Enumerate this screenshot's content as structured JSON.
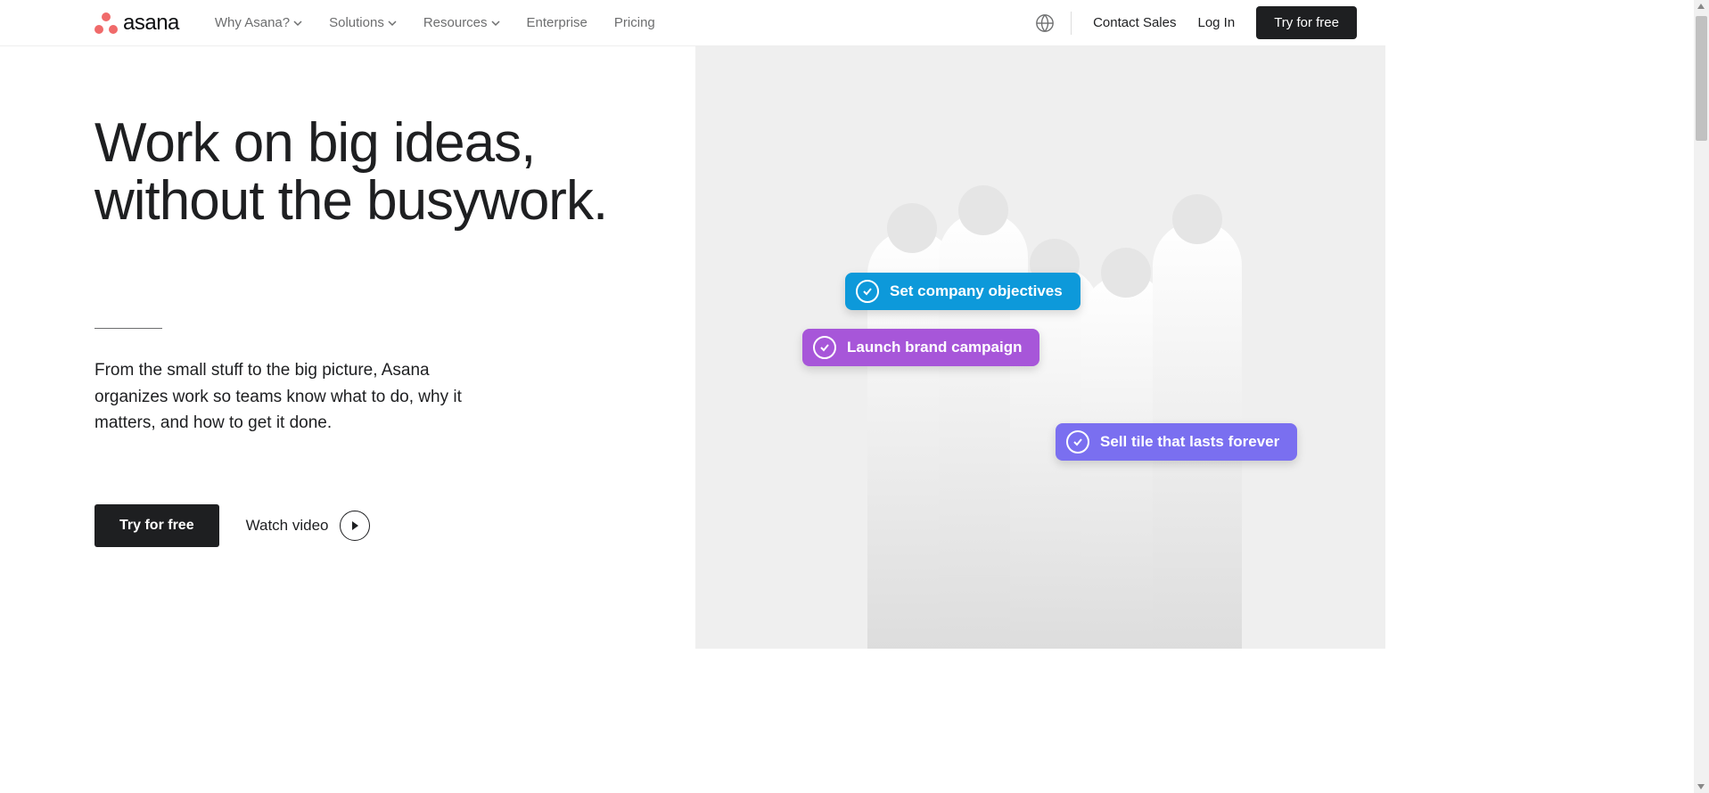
{
  "nav": {
    "logo_text": "asana",
    "items": [
      {
        "label": "Why Asana?",
        "dropdown": true
      },
      {
        "label": "Solutions",
        "dropdown": true
      },
      {
        "label": "Resources",
        "dropdown": true
      },
      {
        "label": "Enterprise",
        "dropdown": false
      },
      {
        "label": "Pricing",
        "dropdown": false
      }
    ],
    "contact": "Contact Sales",
    "login": "Log In",
    "cta": "Try for free"
  },
  "hero": {
    "title_line1": "Work on big ideas,",
    "title_line2": "without the busywork.",
    "subtitle": "From the small stuff to the big picture, Asana organizes work so teams know what to do, why it matters, and how to get it done.",
    "cta_primary": "Try for free",
    "cta_secondary": "Watch video"
  },
  "pills": [
    {
      "label": "Set company objectives",
      "color": "blue"
    },
    {
      "label": "Launch brand campaign",
      "color": "purple"
    },
    {
      "label": "Sell tile that lasts forever",
      "color": "violet"
    }
  ]
}
